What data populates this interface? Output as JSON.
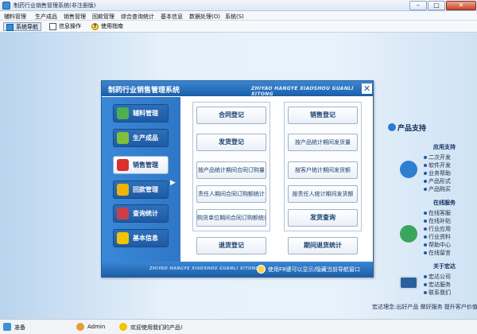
{
  "window": {
    "title": "制药行业销售管理系统(非注册版)",
    "controls": {
      "minimize": "–",
      "maximize": "□",
      "close": "✕"
    }
  },
  "menubar": [
    "辅料管理",
    "生产成品",
    "销售管理",
    "回款管理",
    "综合查询统计",
    "基本信息",
    "数据处理(O)",
    "系统(S)"
  ],
  "toolbar": {
    "nav": "系统导航",
    "info": "信息操作",
    "help": "使用指南"
  },
  "dialog": {
    "title": "制药行业销售管理系统",
    "subtitle": "ZHIYAO HANGYE XIAOSHOU GUANLI XITONG",
    "close": "✕",
    "sidebar": [
      {
        "label": "辅料管理",
        "icon": "materials-icon",
        "color": "#4caf50"
      },
      {
        "label": "生产成品",
        "icon": "products-icon",
        "color": "#7fbf3a"
      },
      {
        "label": "销售管理",
        "icon": "sales-icon",
        "color": "#d9302b",
        "active": true
      },
      {
        "label": "回款管理",
        "icon": "payment-icon",
        "color": "#f0b400"
      },
      {
        "label": "查询统计",
        "icon": "query-icon",
        "color": "#c9404a"
      },
      {
        "label": "基本信息",
        "icon": "info-icon",
        "color": "#f0c400"
      }
    ],
    "left_group": {
      "contract_register": "合同登记",
      "delivery_register": "发货登记",
      "by_product_contract_qty": "按产品统计期间合同订购量",
      "by_person_contract_amount": "责任人期间合同订购额统计",
      "by_unit_contract_amount": "购货单位期间合同订购额统计"
    },
    "right_group": {
      "sales_register": "销售登记",
      "by_product_delivery_qty": "按产品统计期间发货量",
      "by_customer_delivery_amount": "按客户统计期间发货额",
      "by_person_delivery_amount": "按责任人统计期间发货额",
      "delivery_query": "发货查询"
    },
    "return_register": "退货登记",
    "return_stats": "期间退货统计",
    "footer_sub": "ZHIYAO HANGYE XIAOSHOU GUANLI XITONG",
    "footer_hint": "使用F8键可以显示/隐藏当前导航窗口"
  },
  "right_panel": {
    "heading": "产品支持",
    "section1": {
      "title": "应用支持",
      "items": [
        "二次开发",
        "软件开发",
        "业务帮助",
        "产品形式",
        "产品购买"
      ]
    },
    "section2": {
      "title": "在线服务",
      "items": [
        "在线客服",
        "在线补贴",
        "行业应用",
        "行业资料",
        "帮助中心",
        "在线留言"
      ]
    },
    "section3": {
      "title": "关于宏达",
      "items": [
        "宏达公司",
        "宏达服务",
        "联系我们"
      ]
    },
    "footer": "宏达理念:出好产品  做好服务  提升客户价值!"
  },
  "statusbar": {
    "ready": "准备",
    "user": "Admin",
    "welcome": "欢迎使用我们的产品!"
  }
}
